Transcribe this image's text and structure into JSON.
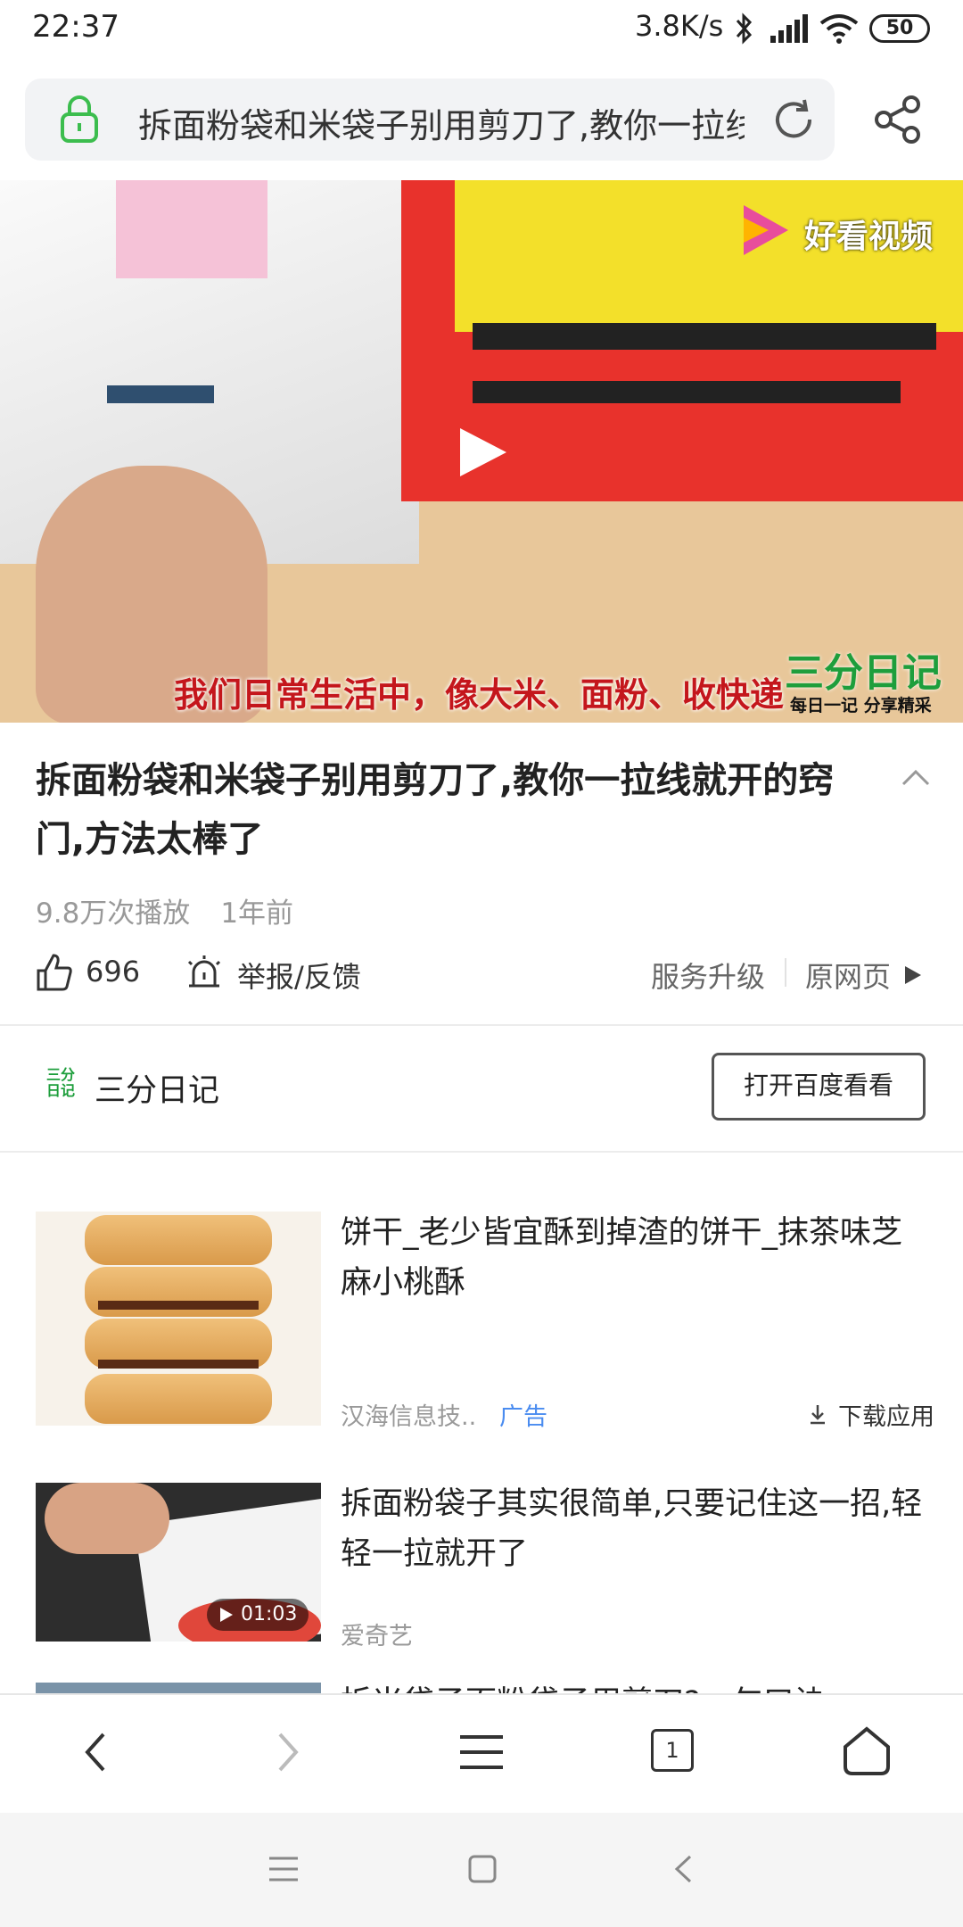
{
  "status": {
    "time": "22:37",
    "net_speed": "3.8K/s",
    "battery": "50"
  },
  "urlbar": {
    "text": "拆面粉袋和米袋子别用剪刀了,教你一拉线就开的窍门,方法太棒了"
  },
  "video": {
    "watermark": "好看视频",
    "brand_name": "三分日记",
    "brand_slogan": "每日一记 分享精采",
    "subtitle": "我们日常生活中，像大米、面粉、收快递"
  },
  "article": {
    "title": "拆面粉袋和米袋子别用剪刀了,教你一拉线就开的窍门,方法太棒了",
    "plays": "9.8万次播放",
    "age": "1年前",
    "likes": "696",
    "report_label": "举报/反馈",
    "service_label": "服务升级",
    "original_label": "原网页"
  },
  "author": {
    "logo_text": "三分日记",
    "name": "三分日记",
    "open_button": "打开百度看看"
  },
  "feed": [
    {
      "title": "饼干_老少皆宜酥到掉渣的饼干_抹茶味芝麻小桃酥",
      "source": "汉海信息技..",
      "ad_label": "广告",
      "download_label": "下载应用"
    },
    {
      "title": "拆面粉袋子其实很简单,只要记住这一招,轻轻一拉就开了",
      "source": "爱奇艺",
      "duration": "01:03"
    },
    {
      "title": "拆米袋子面粉袋子用剪刀?一句口诀"
    }
  ],
  "navbar": {
    "tab_count": "1"
  },
  "colors": {
    "brand_green": "#1e9e3c",
    "ad_blue": "#4a8cf0",
    "subtitle_red": "#c4161c"
  }
}
